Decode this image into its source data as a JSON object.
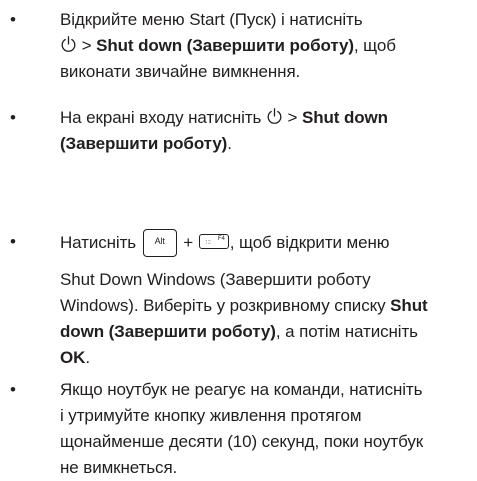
{
  "items": [
    {
      "bullet": "•",
      "line1_pre": "Відкрийте меню Start (Пуск) і натисніть",
      "line2_icon": "power-icon",
      "line2_sep": " > ",
      "line2_bold": "Shut down (Завершити роботу)",
      "line2_post": ", щоб",
      "line3": "виконати звичайне вимкнення."
    },
    {
      "bullet": "•",
      "line1_pre": "На екрані входу натисніть ",
      "line1_icon": "power-icon",
      "line1_sep": " > ",
      "line1_bold": "Shut down",
      "line2_bold": "(Завершити роботу)",
      "line2_post": "."
    },
    {
      "bullet": "•",
      "line1_pre": "Натисніть ",
      "key1_label": "Alt",
      "plus": " + ",
      "key2_label": "F4",
      "line1_post": ", щоб відкрити меню",
      "line2": "Shut Down Windows (Завершити роботу",
      "line3_pre": "Windows). Виберіть у розкривному списку ",
      "line3_bold": "Shut",
      "line4_bold": "down (Завершити роботу)",
      "line4_post": ", а потім натисніть",
      "line5_bold": "OK",
      "line5_post": "."
    },
    {
      "bullet": "•",
      "line1": "Якщо ноутбук не реагує на команди, натисніть",
      "line2": "і утримуйте кнопку живлення протягом",
      "line3": "щонайменше десяти (10) секунд, поки ноутбук",
      "line4": "не вимкнеться."
    }
  ]
}
